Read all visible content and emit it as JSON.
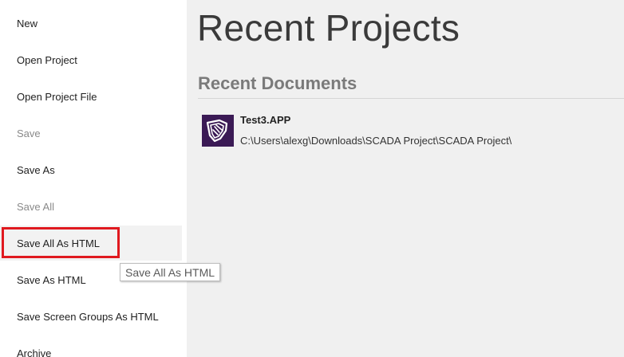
{
  "menu": {
    "items": [
      {
        "label": "New",
        "disabled": false
      },
      {
        "label": "Open Project",
        "disabled": false
      },
      {
        "label": "Open Project File",
        "disabled": false
      },
      {
        "label": "Save",
        "disabled": true
      },
      {
        "label": "Save As",
        "disabled": false
      },
      {
        "label": "Save All",
        "disabled": true
      },
      {
        "label": "Save All As HTML",
        "disabled": false,
        "hovered": true
      },
      {
        "label": "Save As HTML",
        "disabled": false
      },
      {
        "label": "Save Screen Groups As HTML",
        "disabled": false
      },
      {
        "label": "Archive",
        "disabled": false
      }
    ]
  },
  "tooltip": {
    "text": "Save All As HTML"
  },
  "main": {
    "title": "Recent Projects",
    "section_title": "Recent Documents",
    "documents": [
      {
        "name": "Test3.APP",
        "path": "C:\\Users\\alexg\\Downloads\\SCADA Project\\SCADA Project\\",
        "icon": "project-app-icon"
      }
    ]
  },
  "colors": {
    "highlight_border": "#e0191f",
    "icon_background": "#3b1a55",
    "sidebar_background": "#ffffff",
    "main_background": "#f0f0f0"
  }
}
